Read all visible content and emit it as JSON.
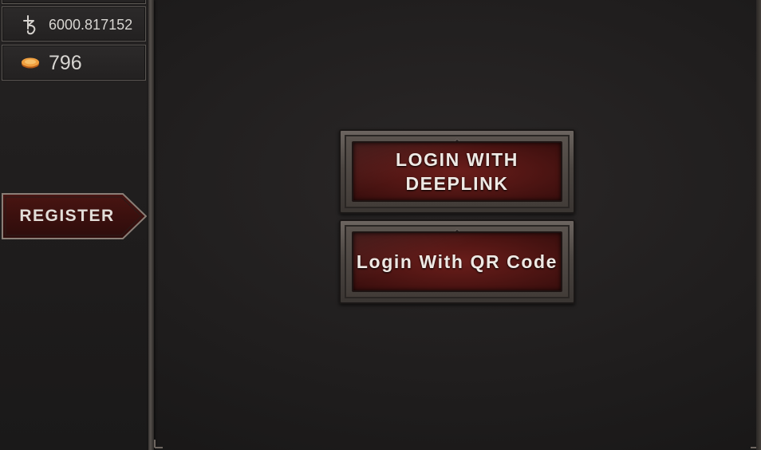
{
  "sidebar": {
    "tez_balance": {
      "icon": "tezos-icon",
      "value": "6000.817152"
    },
    "coin_balance": {
      "icon": "coin-icon",
      "value": "796"
    },
    "register_label": "REGISTER"
  },
  "login_panel": {
    "buttons": [
      {
        "label": "LOGIN WITH DEEPLINK"
      },
      {
        "label": "Login With QR Code"
      }
    ]
  },
  "colors": {
    "accent_plate": "#5a1816",
    "frame": "#4b4541",
    "text": "#efe9e4",
    "coin": "#e8913a"
  }
}
